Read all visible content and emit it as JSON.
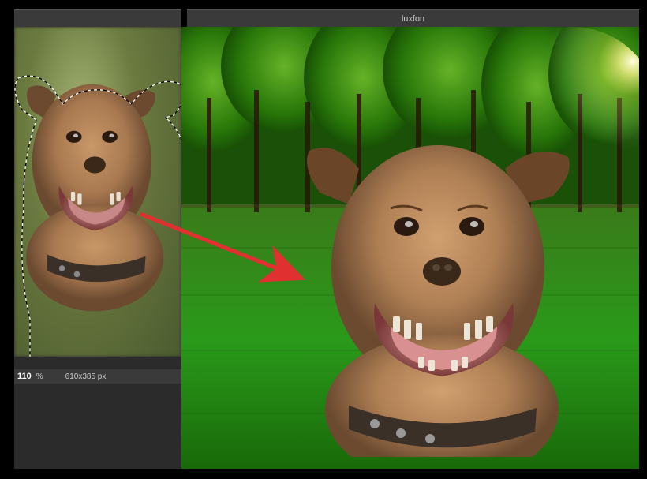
{
  "tabs": {
    "left_title": "",
    "right_title": "luxfon"
  },
  "status": {
    "zoom_value": "110",
    "zoom_unit": "%",
    "dimensions": "610x385 px"
  },
  "colors": {
    "arrow": "#e03030",
    "dark_bg": "#2b2b2b",
    "tab_bg": "#3a3a3a"
  }
}
